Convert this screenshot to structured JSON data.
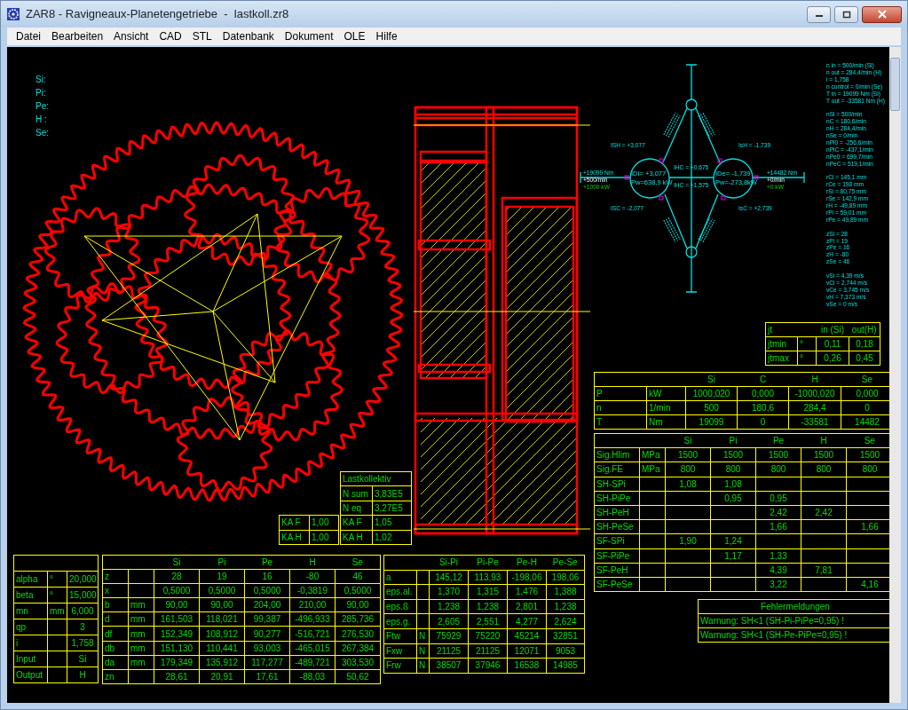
{
  "window": {
    "title": "ZAR8 - Ravigneaux-Planetengetriebe  -  lastkoll.zr8"
  },
  "menu": [
    "Datei",
    "Bearbeiten",
    "Ansicht",
    "CAD",
    "STL",
    "Datenbank",
    "Dokument",
    "OLE",
    "Hilfe"
  ],
  "shaft_labels": [
    "Si:",
    "Pi:",
    "Pe:",
    "H :",
    "Se:"
  ],
  "diagram": {
    "left_labels": [
      "+19099 Nm",
      "+500/min",
      "+1000 kW"
    ],
    "right_labels": [
      "+14482 Nm",
      "+0/min",
      "+0 kW"
    ],
    "left_node": [
      "IDI= +3,077",
      "Pw=638,9 kW"
    ],
    "right_node": [
      "IDe= -1,739",
      "Pw=-273,8kW"
    ],
    "ratio_labels": [
      "ISH = +3,077",
      "IsH = -1,739",
      "IHC = +0,675",
      "IHC = +1,575",
      "ISC = -2,077",
      "IsC = +2,739"
    ]
  },
  "results": [
    [
      "n in = 500/min (Si)",
      "n out = 284,4/min (H)",
      "i = 1,758",
      "n control = 0/min (Se)",
      "T in = 19099 Nm (Si)",
      "T out = -33581 Nm (H)"
    ],
    [
      "nSi = 500/min",
      "nC = 180,6/min",
      "nH = 284,4/min",
      "nSe = 0/min",
      "nPi0 = -256,6/min",
      "nPiC = -437,1/min",
      "nPe0 = 699,7/min",
      "nPeC = 519,1/min"
    ],
    [
      "rCi = 145,1 mm",
      "rCe = 198 mm",
      "rSi = 80,75 mm",
      "rSe = 142,9 mm",
      "rH = -49,89 mm",
      "rPi = 59,01 mm",
      "rPe = 49,89 mm"
    ],
    [
      "zSi = 28",
      "zPi = 19",
      "zPe = 16",
      "zH = -80",
      "zSe = 46"
    ],
    [
      "vSi = 4,39 m/s",
      "vCi = 2,744 m/s",
      "vCe = 3,745 m/s",
      "vH = 7,373 m/s",
      "vSe = 0 m/s"
    ]
  ],
  "tables": [
    {
      "kind": "jt",
      "header": [
        "jt",
        "in (Si)",
        "out(H)"
      ],
      "rows": [
        [
          "jtmin",
          "°",
          "0,11",
          "0,18"
        ],
        [
          "jtmax",
          "°",
          "0,26",
          "0,45"
        ]
      ]
    },
    {
      "kind": "power",
      "header": [
        "Si",
        "C",
        "H",
        "Se"
      ],
      "rows": [
        [
          "P",
          "kW",
          "1000,020",
          "0,000",
          "-1000,020",
          "0,000"
        ],
        [
          "n",
          "1/min",
          "500",
          "180,6",
          "284,4",
          "0"
        ],
        [
          "T",
          "Nm",
          "19099",
          "0",
          "-33581",
          "14482"
        ]
      ]
    },
    {
      "kind": "strength",
      "header": [
        "Si",
        "Pi",
        "Pe",
        "H",
        "Se"
      ],
      "rows": [
        [
          "Sig.Hlim",
          "MPa",
          "1500",
          "1500",
          "1500",
          "1500",
          "1500"
        ],
        [
          "Sig.FE",
          "MPa",
          "800",
          "800",
          "800",
          "800",
          "800"
        ],
        [
          "SH-SPi",
          null,
          "1,08",
          "1,08",
          null,
          null,
          null
        ],
        [
          "SH-PiPe",
          null,
          null,
          "0,95",
          "0,95",
          null,
          null
        ],
        [
          "SH-PeH",
          null,
          null,
          null,
          "2,42",
          "2,42",
          null
        ],
        [
          "SH-PeSe",
          null,
          null,
          null,
          "1,66",
          null,
          "1,66"
        ],
        [
          "SF-SPi",
          null,
          "1,90",
          "1,24",
          null,
          null,
          null
        ],
        [
          "SF-PiPe",
          null,
          null,
          "1,17",
          "1,33",
          null,
          null
        ],
        [
          "SF-PeH",
          null,
          null,
          null,
          "4,39",
          "7,81",
          null
        ],
        [
          "SF-PeSe",
          null,
          null,
          null,
          "3,22",
          null,
          "4,16"
        ]
      ]
    },
    {
      "kind": "messages",
      "header": [
        "Fehlermeldungen"
      ],
      "rows": [
        [
          "Warnung: SH<1 (SH-Pi-PiPe=0,95) !"
        ],
        [
          "Warnung: SH<1 (SH-Pe-PiPe=0,95) !"
        ]
      ]
    },
    {
      "kind": "ka",
      "rows": [
        [
          "KA F",
          "1,00"
        ],
        [
          "KA H",
          "1,00"
        ]
      ]
    },
    {
      "kind": "load",
      "header": [
        "Lastkollektiv"
      ],
      "rows": [
        [
          "N sum",
          "3,83E5"
        ],
        [
          "N eq",
          "3,27E5"
        ],
        [
          "KA F",
          "1,05"
        ],
        [
          "KA H",
          "1,02"
        ]
      ]
    },
    {
      "kind": "params",
      "rows": [
        [
          "alpha",
          "°",
          "20,000"
        ],
        [
          "beta",
          "°",
          "15,000"
        ],
        [
          "mn",
          "mm",
          "6,000"
        ],
        [
          "qp",
          null,
          "3"
        ],
        [
          "i",
          null,
          "1,758"
        ],
        [
          "Input",
          null,
          "Si"
        ],
        [
          "Output",
          null,
          "H"
        ]
      ]
    },
    {
      "kind": "gears",
      "header": [
        "Si",
        "Pi",
        "Pe",
        "H",
        "Se"
      ],
      "rows": [
        [
          "z",
          null,
          "28",
          "19",
          "16",
          "-80",
          "46"
        ],
        [
          "x",
          null,
          "0,5000",
          "0,5000",
          "0,5000",
          "-0,3819",
          "0,5000"
        ],
        [
          "b",
          "mm",
          "90,00",
          "90,00",
          "204,00",
          "210,00",
          "90,00"
        ],
        [
          "d",
          "mm",
          "161,503",
          "118,021",
          "99,387",
          "-496,933",
          "285,736"
        ],
        [
          "df",
          "mm",
          "152,349",
          "108,912",
          "90,277",
          "-516,721",
          "276,530"
        ],
        [
          "db",
          "mm",
          "151,130",
          "110,441",
          "93,003",
          "-465,015",
          "267,384"
        ],
        [
          "da",
          "mm",
          "179,349",
          "135,912",
          "117,277",
          "-489,721",
          "303,530"
        ],
        [
          "zn",
          null,
          "28,61",
          "20,91",
          "17,61",
          "-88,03",
          "50,62"
        ]
      ]
    },
    {
      "kind": "mesh",
      "header": [
        "Si-Pi",
        "Pi-Pe",
        "Pe-H",
        "Pe-Se"
      ],
      "rows": [
        [
          "a",
          null,
          "145,12",
          "113,93",
          "-198,06",
          "198,06"
        ],
        [
          "eps.al.",
          null,
          "1,370",
          "1,315",
          "1,476",
          "1,388"
        ],
        [
          "eps.ß",
          null,
          "1,238",
          "1,238",
          "2,801",
          "1,238"
        ],
        [
          "eps.g.",
          null,
          "2,605",
          "2,551",
          "4,277",
          "2,624"
        ],
        [
          "Ftw",
          "N",
          "75929",
          "75220",
          "45214",
          "32851"
        ],
        [
          "Fxw",
          "N",
          "21125",
          "21125",
          "12071",
          "9053"
        ],
        [
          "Frw",
          "N",
          "38507",
          "37946",
          "16538",
          "14985"
        ]
      ]
    }
  ]
}
